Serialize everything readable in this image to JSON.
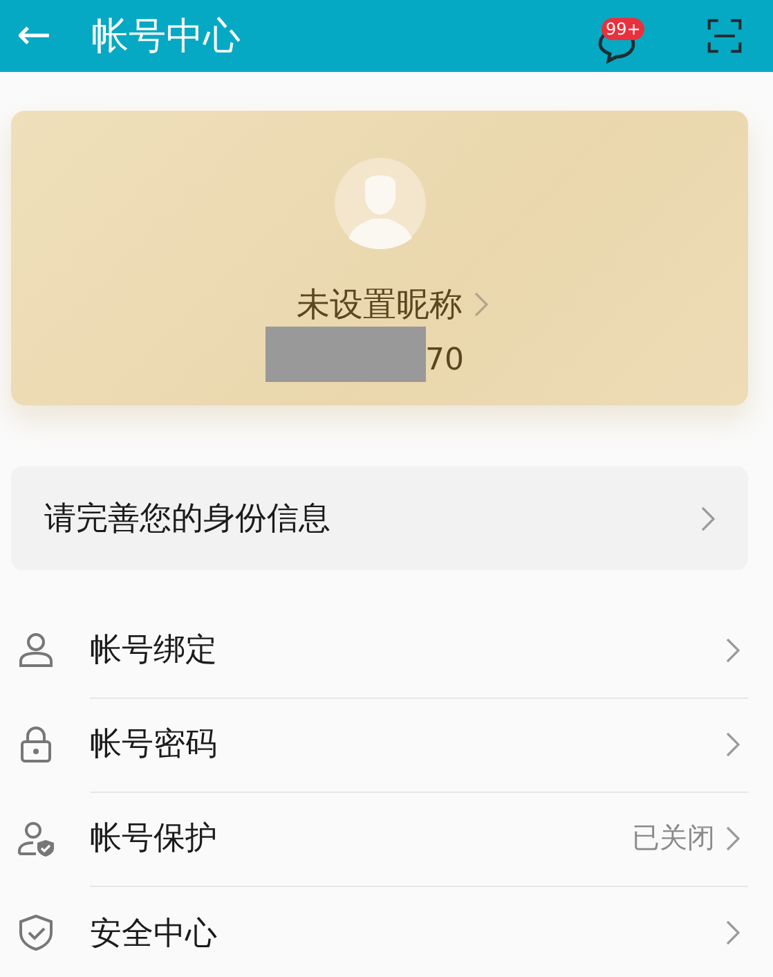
{
  "header": {
    "back": "←",
    "title": "帐号中心",
    "badge": "99+"
  },
  "profile": {
    "nickname": "未设置昵称",
    "account_tail": "70"
  },
  "notice": {
    "label": "请完善您的身份信息"
  },
  "items": [
    {
      "label": "帐号绑定"
    },
    {
      "label": "帐号密码"
    },
    {
      "label": "帐号保护",
      "value": "已关闭"
    },
    {
      "label": "安全中心"
    }
  ]
}
